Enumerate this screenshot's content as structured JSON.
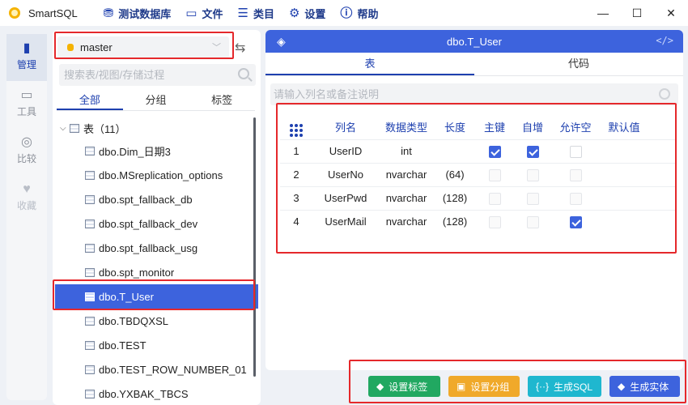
{
  "app": {
    "name": "SmartSQL",
    "menu": [
      {
        "icon": "database-icon",
        "glyph": "⛃",
        "label": "测试数据库"
      },
      {
        "icon": "folder-icon",
        "glyph": "▭",
        "label": "文件"
      },
      {
        "icon": "list-icon",
        "glyph": "☰",
        "label": "类目"
      },
      {
        "icon": "gear-icon",
        "glyph": "⚙",
        "label": "设置"
      },
      {
        "icon": "info-icon",
        "glyph": "ⓘ",
        "label": "帮助"
      }
    ]
  },
  "rail": [
    {
      "icon": "book-icon",
      "glyph": "▮",
      "label": "管理",
      "state": "active"
    },
    {
      "icon": "inbox-icon",
      "glyph": "▭",
      "label": "工具",
      "state": "normal"
    },
    {
      "icon": "compass-icon",
      "glyph": "◎",
      "label": "比较",
      "state": "normal"
    },
    {
      "icon": "heart-icon",
      "glyph": "♥",
      "label": "收藏",
      "state": "disabled"
    }
  ],
  "objects": {
    "database": "master",
    "search_placeholder": "搜索表/视图/存储过程",
    "tabs": [
      "全部",
      "分组",
      "标签"
    ],
    "tree_root": "表（11）",
    "items": [
      "dbo.Dim_日期3",
      "dbo.MSreplication_options",
      "dbo.spt_fallback_db",
      "dbo.spt_fallback_dev",
      "dbo.spt_fallback_usg",
      "dbo.spt_monitor",
      "dbo.T_User",
      "dbo.TBDQXSL",
      "dbo.TEST",
      "dbo.TEST_ROW_NUMBER_01",
      "dbo.YXBAK_TBCS"
    ],
    "selected": "dbo.T_User"
  },
  "editor": {
    "title": "dbo.T_User",
    "tabs": [
      "表",
      "代码"
    ],
    "search_placeholder": "请输入列名或备注说明",
    "columns": [
      "列名",
      "数据类型",
      "长度",
      "主键",
      "自增",
      "允许空",
      "默认值"
    ],
    "rows": [
      {
        "no": "1",
        "name": "UserID",
        "type": "int",
        "length": "",
        "pk": true,
        "auto": true,
        "nullable": false,
        "pk_disabled": false,
        "default": ""
      },
      {
        "no": "2",
        "name": "UserNo",
        "type": "nvarchar",
        "length": "(64)",
        "pk": false,
        "auto": false,
        "nullable": false,
        "pk_disabled": true,
        "default": ""
      },
      {
        "no": "3",
        "name": "UserPwd",
        "type": "nvarchar",
        "length": "(128)",
        "pk": false,
        "auto": false,
        "nullable": false,
        "pk_disabled": true,
        "default": ""
      },
      {
        "no": "4",
        "name": "UserMail",
        "type": "nvarchar",
        "length": "(128)",
        "pk": false,
        "auto": false,
        "nullable": true,
        "pk_disabled": true,
        "default": ""
      }
    ]
  },
  "actions": {
    "set_tag": "设置标签",
    "set_group": "设置分组",
    "gen_sql": "生成SQL",
    "gen_entity": "生成实体"
  },
  "colors": {
    "accent": "#3d63dd",
    "highlight": "#e5282b",
    "green": "#21a861",
    "orange": "#f0a92a",
    "cyan": "#1fb7cf"
  }
}
